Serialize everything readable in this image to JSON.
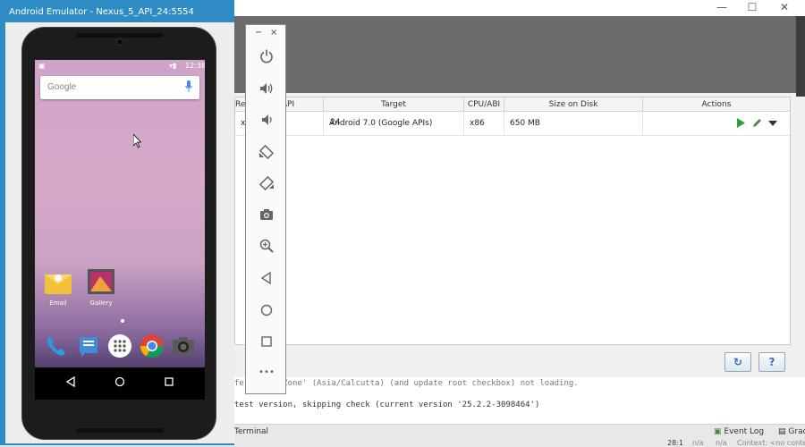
{
  "emulator": {
    "title": "Android Emulator - Nexus_5_API_24:5554",
    "status_time": "12:38",
    "search": {
      "logo": "Google"
    },
    "apps": [
      {
        "label": "Email",
        "icon": "email-icon"
      },
      {
        "label": "Gallery",
        "icon": "gallery-icon"
      }
    ],
    "dock": [
      "phone-icon",
      "messages-icon",
      "app-drawer-icon",
      "chrome-icon",
      "camera-icon"
    ],
    "nav": [
      "back-icon",
      "home-icon",
      "recents-icon"
    ],
    "toolbar": {
      "minimize": "−",
      "close": "×",
      "buttons": [
        "power-icon",
        "volume-up-icon",
        "volume-down-icon",
        "rotate-left-icon",
        "rotate-right-icon",
        "screenshot-icon",
        "zoom-icon",
        "back-icon",
        "home-icon",
        "overview-icon",
        "more-icon"
      ],
      "more_label": "•••"
    }
  },
  "avd_manager": {
    "window_controls": {
      "minimize": "—",
      "maximize": "☐",
      "close": "✕"
    },
    "columns": [
      "Res",
      "API",
      "Target",
      "CPU/ABI",
      "Size on Disk",
      "Actions"
    ],
    "rows": [
      {
        "resolution": "xxl",
        "api": "24",
        "target": "Android 7.0 (Google APIs)",
        "cpu_abi": "x86",
        "size": "650 MB"
      }
    ],
    "buttons": {
      "refresh": "↻",
      "help": "?"
    },
    "colors": {
      "play": "#2e9e3e",
      "edit": "#4a8a3a"
    }
  },
  "log": {
    "line1": "test version, skipping check (current version '25.2.2-3098464')",
    "line0_partial": "fest Time Zone' (Asia/Calcutta) (and update root checkbox) not loading."
  },
  "statusbar": {
    "terminal": "Terminal",
    "event_log": "Event Log",
    "gradle": "Grad",
    "position": "28:1",
    "na1": "n/a",
    "na2": "n/a",
    "context": "Context: <no context>"
  }
}
